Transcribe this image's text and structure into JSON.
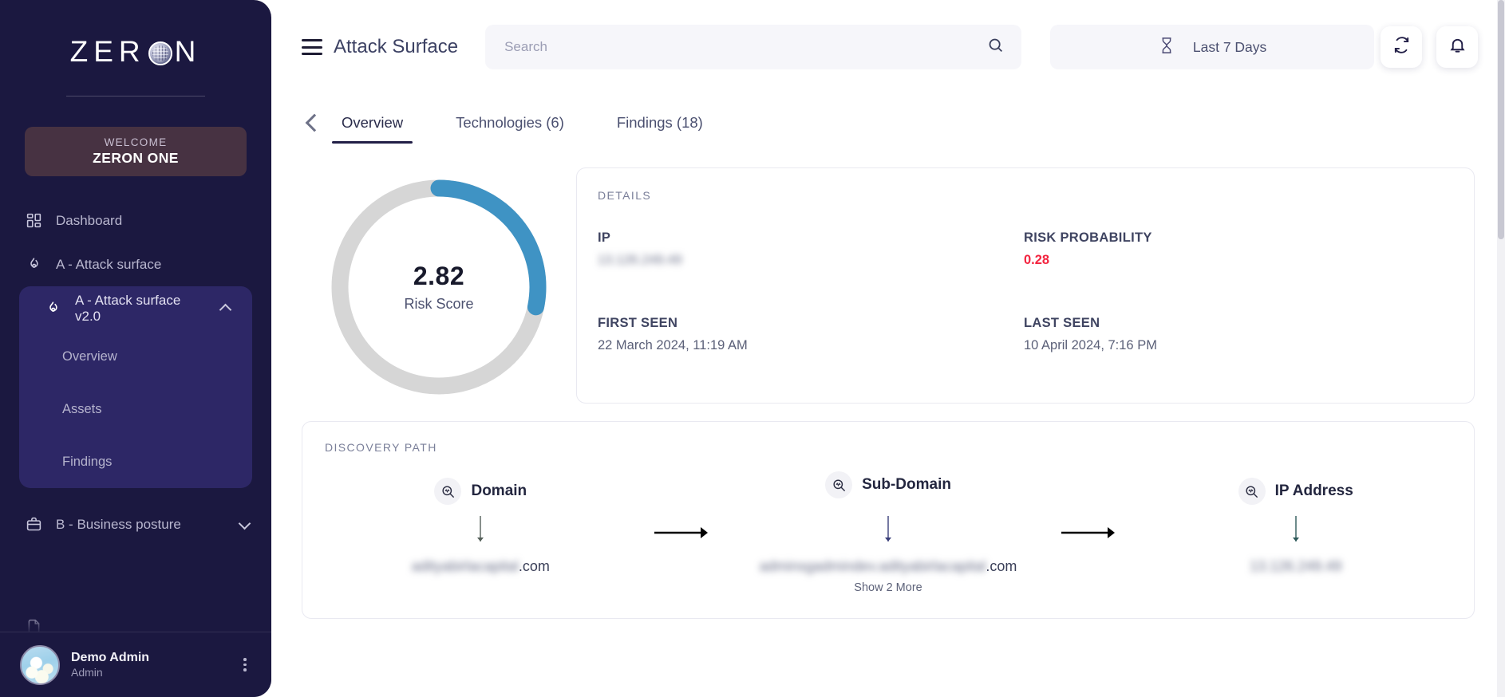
{
  "brand": {
    "logo_text": "ZERON",
    "globe_icon": "globe-icon"
  },
  "sidebar": {
    "welcome": {
      "label": "WELCOME",
      "name": "ZERON ONE"
    },
    "items": [
      {
        "label": "Dashboard",
        "icon": "dashboard-grid-icon"
      },
      {
        "label": "A - Attack surface",
        "icon": "flame-icon"
      },
      {
        "label": "A - Attack surface v2.0",
        "icon": "flame-icon",
        "chevron": "chevron-up-icon",
        "expanded": true
      },
      {
        "label": "B - Business posture",
        "icon": "briefcase-icon",
        "chevron": "chevron-down-icon",
        "expanded": false
      }
    ],
    "subitems": [
      {
        "label": "Overview"
      },
      {
        "label": "Assets"
      },
      {
        "label": "Findings"
      }
    ],
    "user": {
      "name": "Demo Admin",
      "role": "Admin",
      "avatar": "avatar",
      "menu_icon": "kebab-menu-icon"
    }
  },
  "header": {
    "menu_icon": "hamburger-menu-icon",
    "title": "Attack Surface",
    "search": {
      "value": "",
      "placeholder": "Search",
      "icon": "search-icon"
    },
    "date_filter": {
      "label": "Last 7 Days",
      "icon": "hourglass-icon"
    },
    "refresh_icon": "refresh-icon",
    "notification_icon": "bell-icon",
    "back_icon": "chevron-left-icon"
  },
  "tabs": [
    {
      "label": "Overview",
      "active": true
    },
    {
      "label": "Technologies (6)",
      "active": false
    },
    {
      "label": "Findings (18)",
      "active": false
    }
  ],
  "gauge": {
    "value": "2.82",
    "label": "Risk Score",
    "percent": 28.2,
    "arc_color": "#3f93c4",
    "track_color": "#d6d6d6"
  },
  "details": {
    "heading": "DETAILS",
    "fields": [
      {
        "key": "IP",
        "value": "13.126.249.49",
        "redacted": true
      },
      {
        "key": "RISK PROBABILITY",
        "value": "0.28",
        "redacted": false,
        "danger": true
      },
      {
        "key": "FIRST SEEN",
        "value": "22 March 2024, 11:19 AM",
        "redacted": false
      },
      {
        "key": "LAST SEEN",
        "value": "10 April 2024, 7:16 PM",
        "redacted": false
      }
    ]
  },
  "discovery": {
    "heading": "DISCOVERY PATH",
    "nodes": [
      {
        "title": "Domain",
        "icon": "magnifier-scan-icon",
        "value_redacted": "adityabirlacapital",
        "value_suffix": ".com",
        "more": ""
      },
      {
        "title": "Sub-Domain",
        "icon": "magnifier-scan-icon",
        "value_redacted": "adminsgadmindev.adityabirlacapital",
        "value_suffix": ".com",
        "more": "Show 2 More"
      },
      {
        "title": "IP Address",
        "icon": "magnifier-scan-icon",
        "value_redacted": "13.126.249.49",
        "value_suffix": "",
        "more": ""
      }
    ],
    "arrow_icon": "arrow-right-icon",
    "down_arrow_icon": "arrow-down-icon"
  },
  "colors": {
    "sidebar_bg": "#1b1840",
    "sidebar_active": "#2d2766",
    "welcome_bg": "#473242",
    "accent_blue": "#3f93c4",
    "danger_red": "#f3243f",
    "tab_underline": "#221f47"
  }
}
